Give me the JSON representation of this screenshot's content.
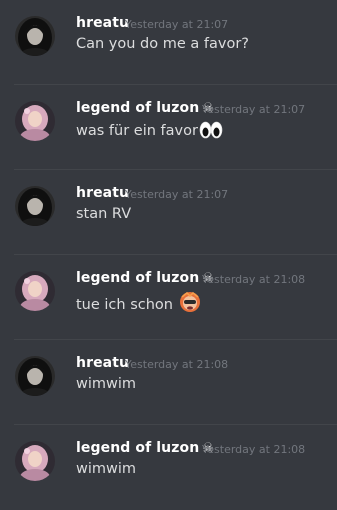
{
  "messages": [
    {
      "author": "hreatu",
      "badge": "",
      "time": "Yesterday at 21:07",
      "text": "Can you do me a favor?",
      "emoji": "",
      "avatar": "dark-hair-avatar"
    },
    {
      "author": "legend of luzon",
      "badge": "☠",
      "time": "Yesterday at 21:07",
      "text": "was für ein favor",
      "emoji": "eyes-emoji",
      "avatar": "pink-avatar"
    },
    {
      "author": "hreatu",
      "badge": "",
      "time": "Yesterday at 21:07",
      "text": "stan RV",
      "emoji": "",
      "avatar": "dark-hair-avatar"
    },
    {
      "author": "legend of luzon",
      "badge": "☠",
      "time": "Yesterday at 21:08",
      "text": "tue ich schon ",
      "emoji": "rv-fan-emoji",
      "avatar": "pink-avatar"
    },
    {
      "author": "hreatu",
      "badge": "",
      "time": "Yesterday at 21:08",
      "text": "wimwim",
      "emoji": "",
      "avatar": "dark-hair-avatar"
    },
    {
      "author": "legend of luzon",
      "badge": "☠",
      "time": "Yesterday at 21:08",
      "text": "wimwim",
      "emoji": "",
      "avatar": "pink-avatar"
    }
  ],
  "colors": {
    "background": "#36393f",
    "username": "#ffffff",
    "timestamp": "#72767d",
    "message_text": "#dcddde"
  }
}
